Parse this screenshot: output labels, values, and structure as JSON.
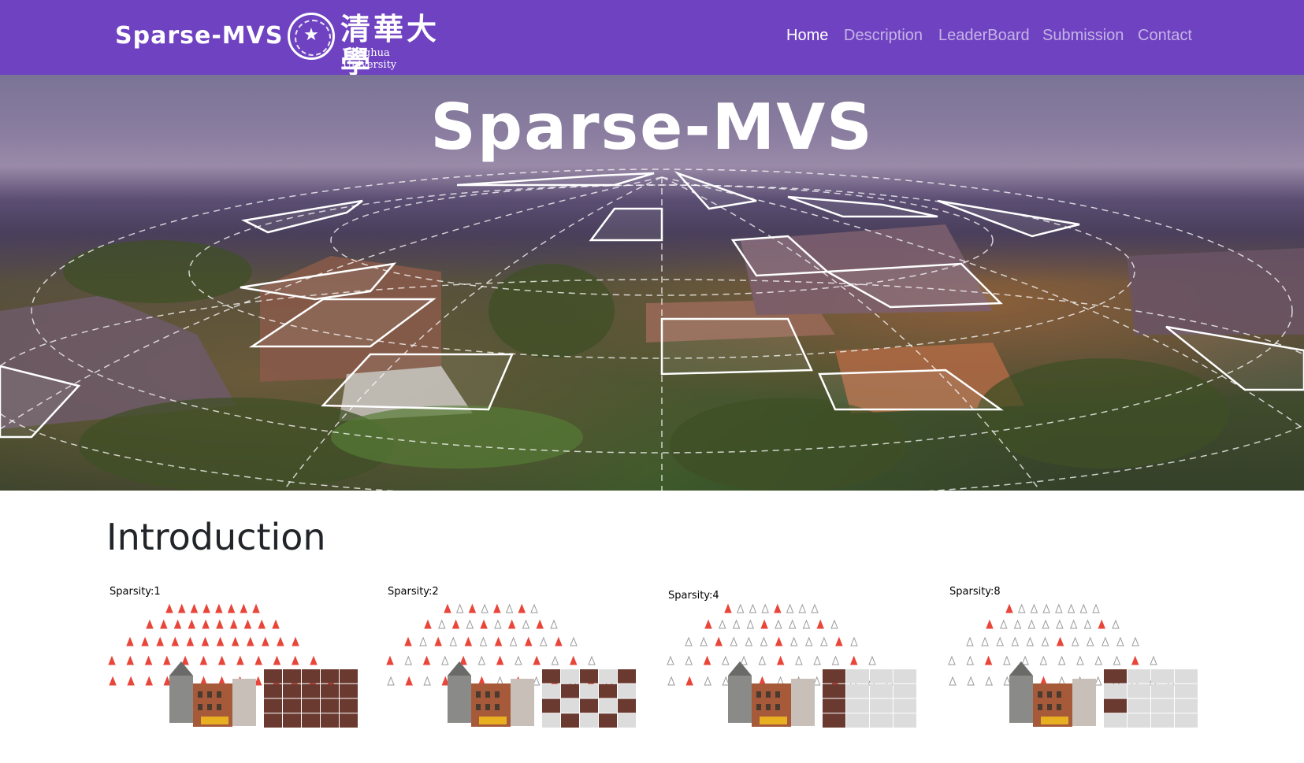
{
  "navbar": {
    "brand": "Sparse-MVS",
    "logo": {
      "chinese": "清華大學",
      "english": "Tsinghua University"
    },
    "links": [
      {
        "label": "Home",
        "active": true
      },
      {
        "label": "Description",
        "active": false
      },
      {
        "label": "LeaderBoard",
        "active": false
      },
      {
        "label": "Submission",
        "active": false
      },
      {
        "label": "Contact",
        "active": false
      }
    ],
    "bg_color": "#6f42c1"
  },
  "hero": {
    "title": "Sparse-MVS"
  },
  "intro": {
    "title": "Introduction",
    "panels": [
      {
        "label": "Sparsity:1"
      },
      {
        "label": "Sparsity:2"
      },
      {
        "label": "Sparsity:4"
      },
      {
        "label": "Sparsity:8"
      }
    ]
  },
  "colors": {
    "camera_red": "#e8463a",
    "camera_gray": "#9a9a9a"
  }
}
